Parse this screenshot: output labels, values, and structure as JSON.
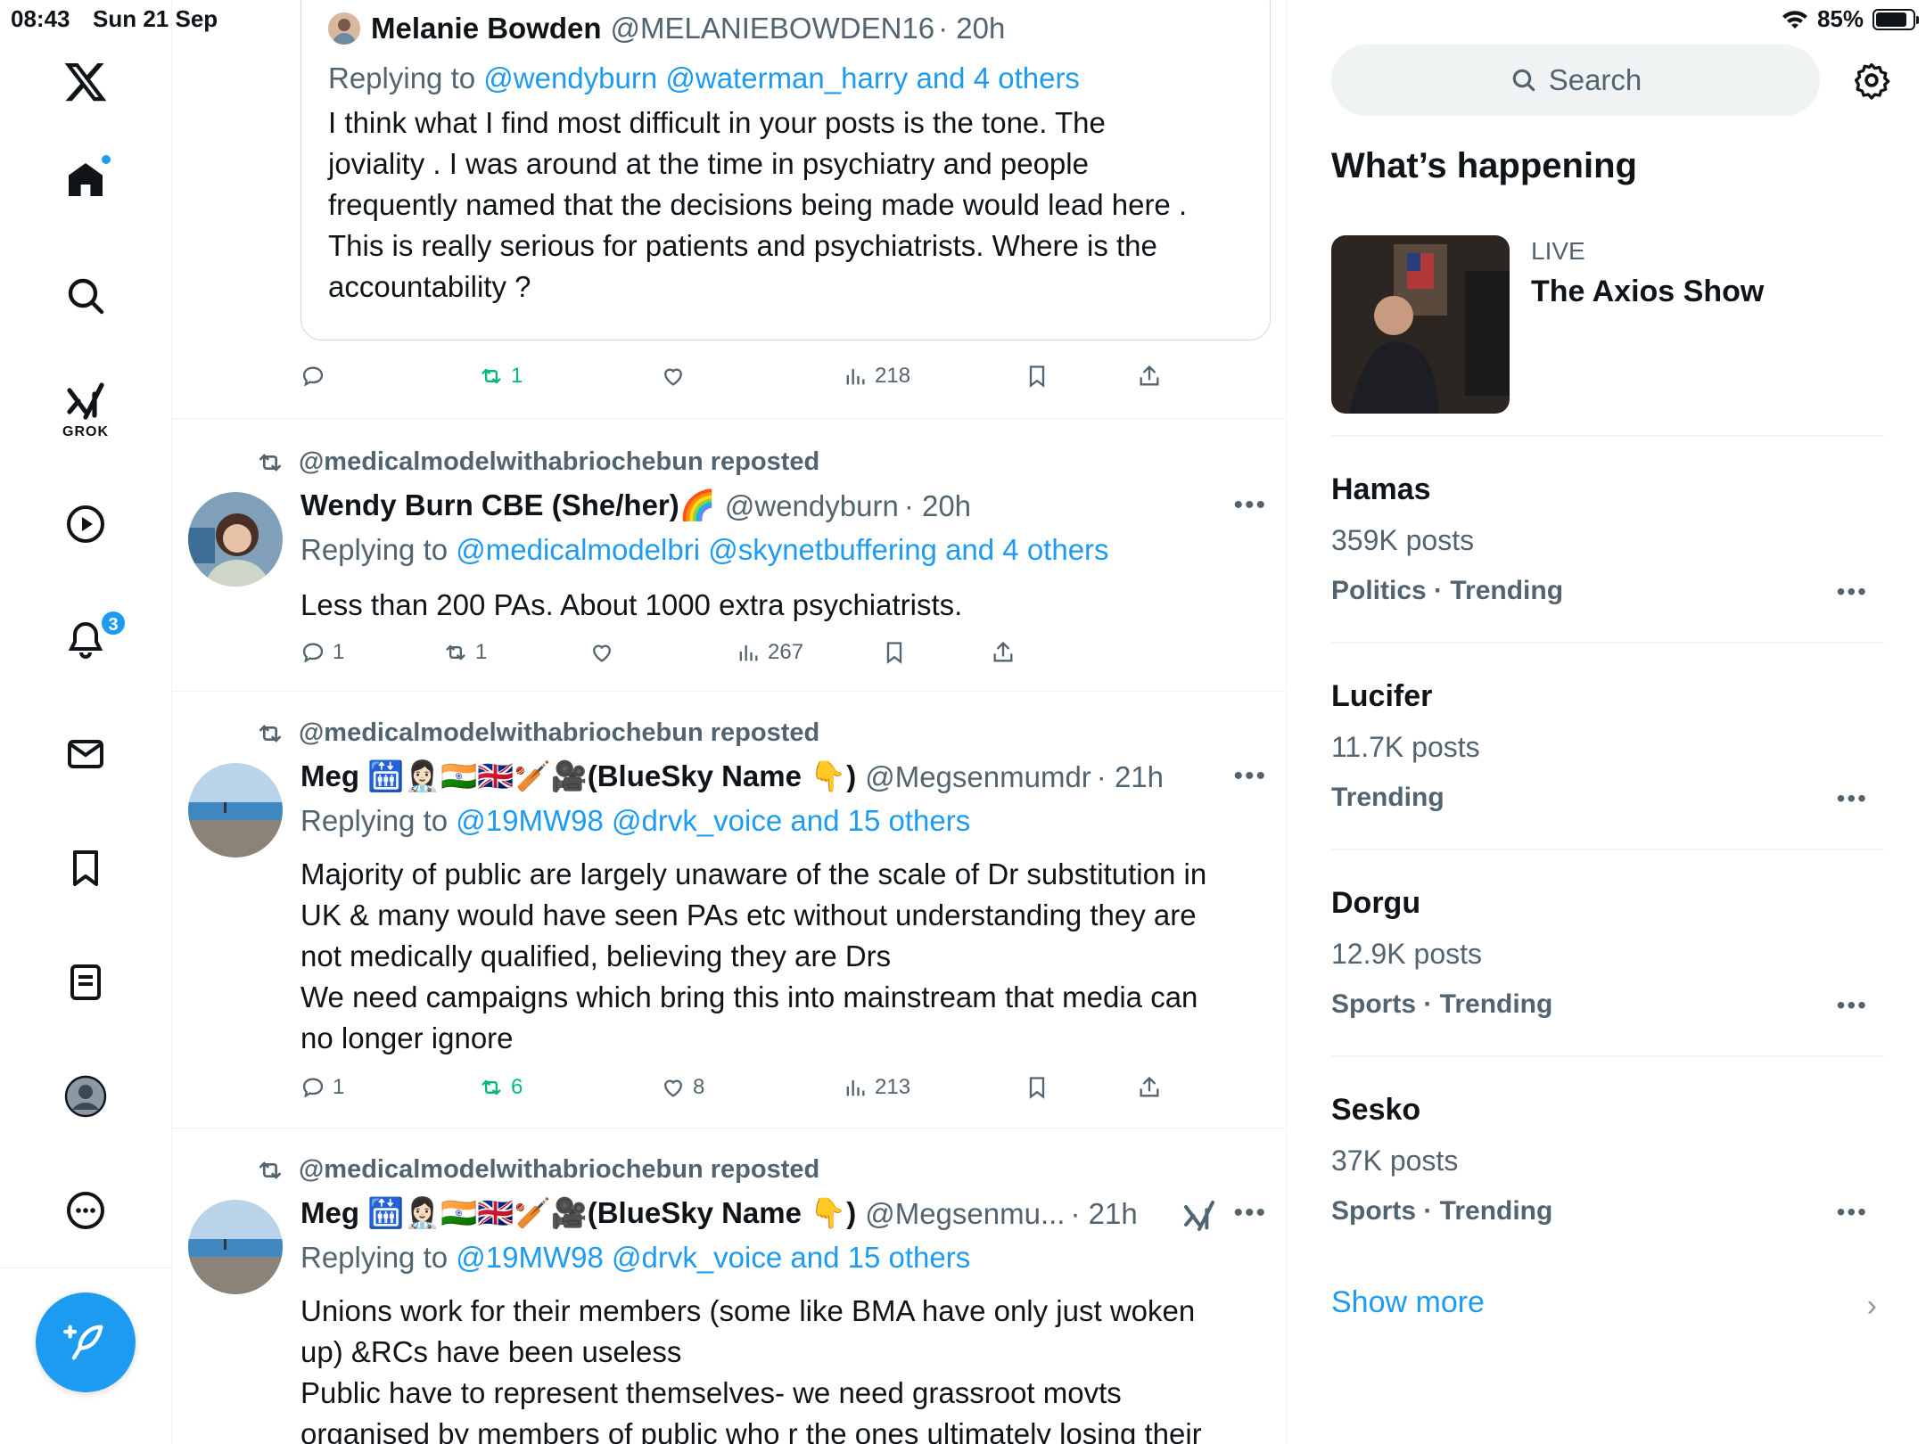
{
  "status_bar": {
    "time": "08:43",
    "date": "Sun 21 Sep",
    "battery": "85%",
    "battery_level": 0.85
  },
  "nav": {
    "grok_label": "GROK",
    "notifications_count": "3"
  },
  "quote": {
    "name": "Melanie Bowden",
    "handle": "@MELANIEBOWDEN16",
    "time": "· 20h",
    "replying_prefix": "Replying to ",
    "replying_to": "@wendyburn @waterman_harry and 4 others",
    "lines": [
      "I think what I find most difficult in your posts is the tone. The",
      "joviality . I was around at the time in psychiatry  and people",
      "frequently named that the decisions being made would lead here .",
      "This is really serious for patients and psychiatrists. Where is the",
      "accountability ?"
    ],
    "actions": {
      "reposts": "1",
      "views": "218"
    }
  },
  "posts": [
    {
      "reposted_by": "@medicalmodelwithabriochebun reposted",
      "name": "Wendy Burn CBE (She/her)🌈",
      "handle": "@wendyburn",
      "time": "· 20h",
      "replying_prefix": "Replying to ",
      "replying_to": "@medicalmodelbri @skynetbuffering and 4 others",
      "lines": [
        "Less than 200 PAs. About 1000 extra psychiatrists."
      ],
      "actions": {
        "replies": "1",
        "reposts": "1",
        "likes": "",
        "views": "267"
      }
    },
    {
      "reposted_by": "@medicalmodelwithabriochebun reposted",
      "name": "Meg 🛗👩🏻‍⚕️🇮🇳🇬🇧🏏🎥(BlueSky Name 👇)",
      "handle": "@Megsenmumdr",
      "time": "· 21h",
      "replying_prefix": "Replying to ",
      "replying_to": "@19MW98 @drvk_voice and 15 others",
      "lines": [
        "Majority of public are largely unaware of the scale of Dr substitution in",
        "UK & many would have seen PAs etc without understanding they are",
        "not medically qualified, believing they are Drs",
        "We need campaigns which bring this into mainstream that media can",
        "no longer ignore"
      ],
      "actions": {
        "replies": "1",
        "reposts": "6",
        "likes": "8",
        "views": "213"
      }
    },
    {
      "reposted_by": "@medicalmodelwithabriochebun reposted",
      "name": "Meg 🛗👩🏻‍⚕️🇮🇳🇬🇧🏏🎥(BlueSky Name 👇)",
      "handle": "@Megsenmu...",
      "time": "· 21h",
      "replying_prefix": "Replying to ",
      "replying_to": "@19MW98 @drvk_voice and 15 others",
      "lines": [
        "Unions work for their members (some like BMA have only just woken",
        "up) &RCs have been useless",
        "Public have to represent themselves- we need grassroot movts",
        "organised by members of public who r the ones ultimately losing their"
      ]
    }
  ],
  "sidebar": {
    "search_placeholder": "Search",
    "whats_happening": "What’s happening",
    "live": {
      "label": "LIVE",
      "title": "The Axios Show"
    },
    "trends": [
      {
        "name": "Hamas",
        "count": "359K posts",
        "category": "Politics · Trending"
      },
      {
        "name": "Lucifer",
        "count": "11.7K posts",
        "category": "Trending"
      },
      {
        "name": "Dorgu",
        "count": "12.9K posts",
        "category": "Sports · Trending"
      },
      {
        "name": "Sesko",
        "count": "37K posts",
        "category": "Sports · Trending"
      }
    ],
    "show_more": "Show more"
  },
  "colors": {
    "accent": "#1d9bf0",
    "repost_green": "#00ba7c",
    "muted": "#536471"
  }
}
